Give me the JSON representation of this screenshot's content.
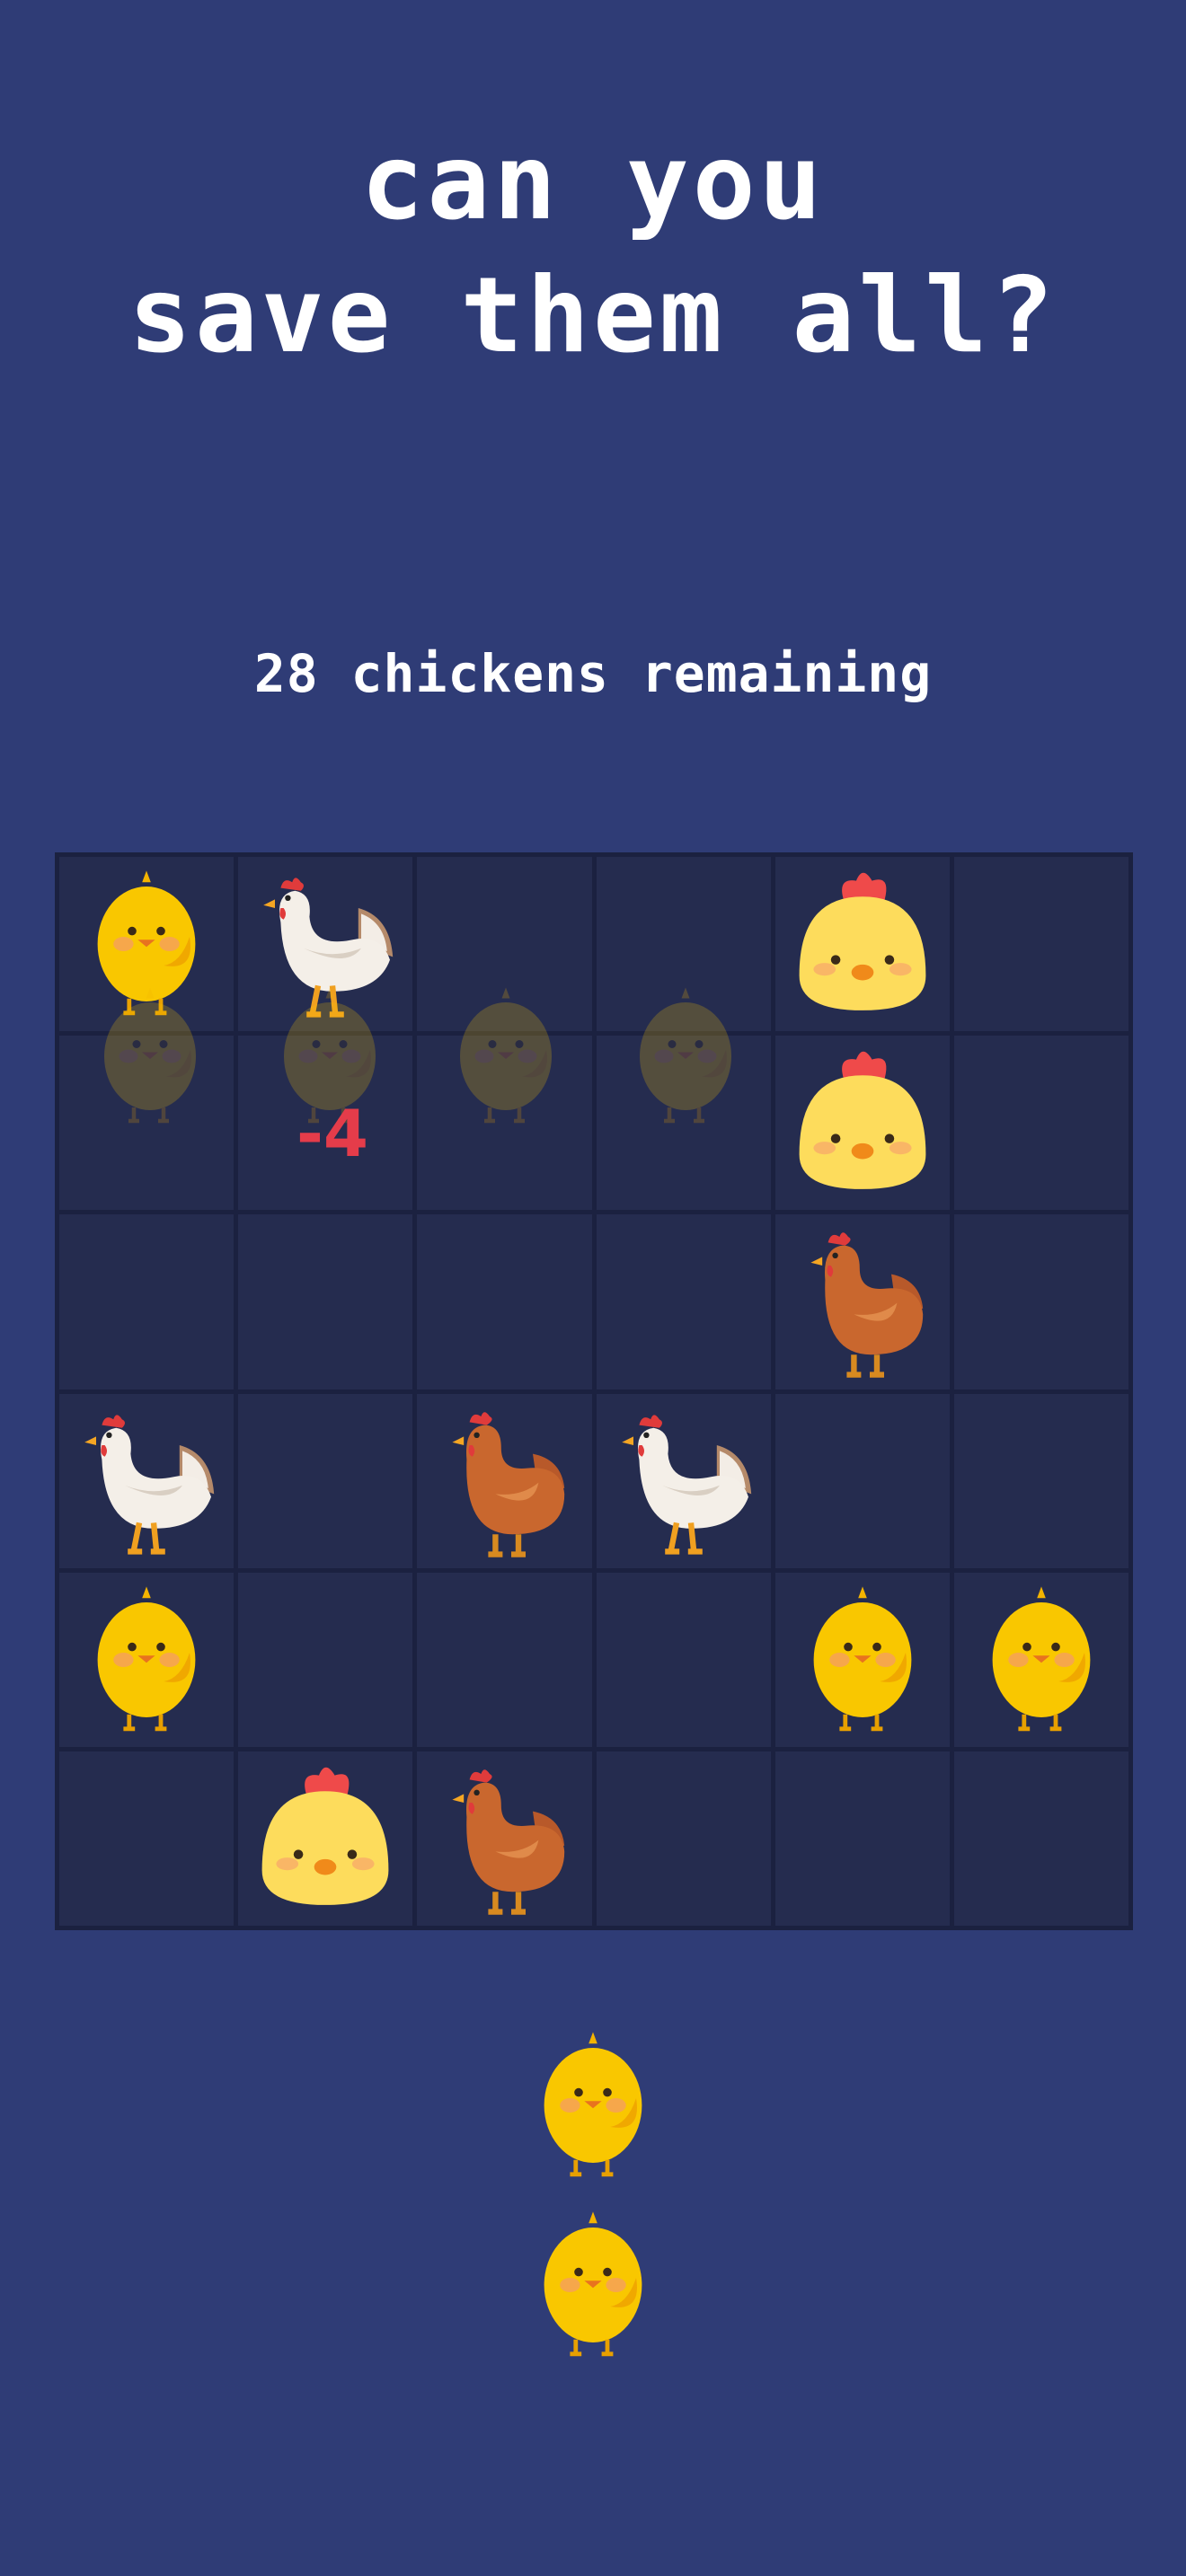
{
  "title": {
    "line1": "can you",
    "line2": "save them all?"
  },
  "status": {
    "remaining": "28 chickens remaining"
  },
  "penalty": "-4",
  "board": {
    "rows": [
      [
        "chick",
        "hen-white",
        "empty",
        "empty",
        "baby",
        "empty"
      ],
      [
        "empty",
        "empty",
        "empty",
        "empty",
        "baby",
        "empty"
      ],
      [
        "empty",
        "empty",
        "empty",
        "empty",
        "hen-brown",
        "empty"
      ],
      [
        "hen-white",
        "empty",
        "hen-brown",
        "hen-white",
        "empty",
        "empty"
      ],
      [
        "chick",
        "empty",
        "empty",
        "empty",
        "chick",
        "chick"
      ],
      [
        "empty",
        "baby",
        "hen-brown",
        "empty",
        "empty",
        "empty"
      ]
    ]
  },
  "queue": [
    "chick",
    "chick"
  ],
  "colors": {
    "background": "#2f3c76",
    "cell": "#252c4f",
    "grid": "#1b2140",
    "penalty": "#e53c4a"
  }
}
